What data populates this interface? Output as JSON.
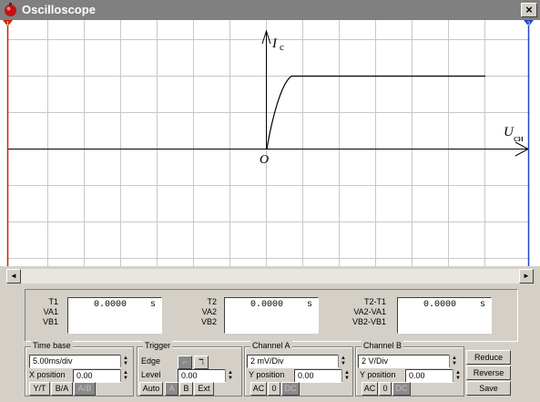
{
  "window": {
    "title": "Oscilloscope",
    "close_label": "×"
  },
  "screen": {
    "y_axis_label": "I",
    "y_axis_sub": "c",
    "x_axis_label": "U",
    "x_axis_sub": "си",
    "origin_label": "O",
    "cursor1_label": "1",
    "cursor2_label": "2",
    "cursor1_color": "#cc2200",
    "cursor2_color": "#2244cc"
  },
  "scrollbar": {
    "left_arrow": "◄",
    "right_arrow": "►"
  },
  "measurements": {
    "col1": {
      "label1": "T1",
      "label2": "VA1",
      "label3": "VB1",
      "value": "0.0000",
      "unit": "s"
    },
    "col2": {
      "label1": "T2",
      "label2": "VA2",
      "label3": "VB2",
      "value": "0.0000",
      "unit": "s"
    },
    "col3": {
      "label1": "T2-T1",
      "label2": "VA2-VA1",
      "label3": "VB2-VB1",
      "value": "0.0000",
      "unit": "s"
    }
  },
  "timebase": {
    "title": "Time base",
    "value": "5.00ms/div",
    "xpos_label": "X position",
    "xpos_value": "0.00",
    "btn_yt": "Y/T",
    "btn_ba": "B/A",
    "btn_ab": "A/B"
  },
  "trigger": {
    "title": "Trigger",
    "edge_label": "Edge",
    "edge_rise": "⌐",
    "edge_fall": "ℸ",
    "level_label": "Level",
    "level_value": "0.00",
    "btn_auto": "Auto",
    "btn_a": "A",
    "btn_b": "B",
    "btn_ext": "Ext"
  },
  "channel_a": {
    "title": "Channel A",
    "value": "2 mV/Div",
    "ypos_label": "Y position",
    "ypos_value": "0.00",
    "btn_ac": "AC",
    "btn_0": "0",
    "btn_dc": "DC"
  },
  "channel_b": {
    "title": "Channel B",
    "value": "2 V/Div",
    "ypos_label": "Y position",
    "ypos_value": "0.00",
    "btn_ac": "AC",
    "btn_0": "0",
    "btn_dc": "DC"
  },
  "actions": {
    "reduce": "Reduce",
    "reverse": "Reverse",
    "save": "Save"
  }
}
